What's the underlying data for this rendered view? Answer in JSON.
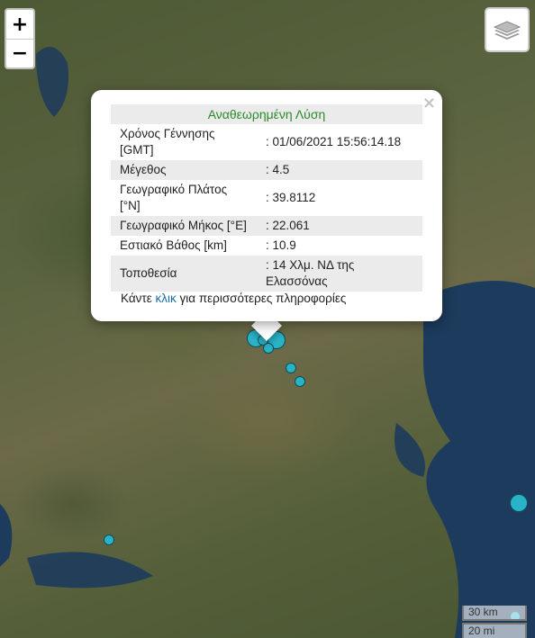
{
  "map": {
    "accent_color": "#2ab3c8",
    "sea_color": "#1d3b5c"
  },
  "controls": {
    "zoom_in": "+",
    "zoom_out": "−",
    "layers_icon": "layers-icon"
  },
  "popup": {
    "header": "Αναθεωρημένη Λύση",
    "close": "×",
    "rows": [
      {
        "label": "Χρόνος Γέννησης [GMT]",
        "value": ": 01/06/2021 15:56:14.18"
      },
      {
        "label": "Μέγεθος",
        "value": ": 4.5"
      },
      {
        "label": "Γεωγραφικό Πλάτος [°N]",
        "value": ": 39.8112"
      },
      {
        "label": "Γεωγραφικό Μήκος [°E]",
        "value": ": 22.061"
      },
      {
        "label": "Εστιακό Βάθος [km]",
        "value": ": 10.9"
      },
      {
        "label": "Τοποθεσία",
        "value": ": 14 Χλμ. ΝΔ της Ελασσόνας"
      }
    ],
    "more_prefix": "Κάντε",
    "more_link": "κλικ",
    "more_suffix": "για περισσότερες πληροφορίες"
  },
  "scale": {
    "km": "30 km",
    "mi": "20 mi"
  }
}
